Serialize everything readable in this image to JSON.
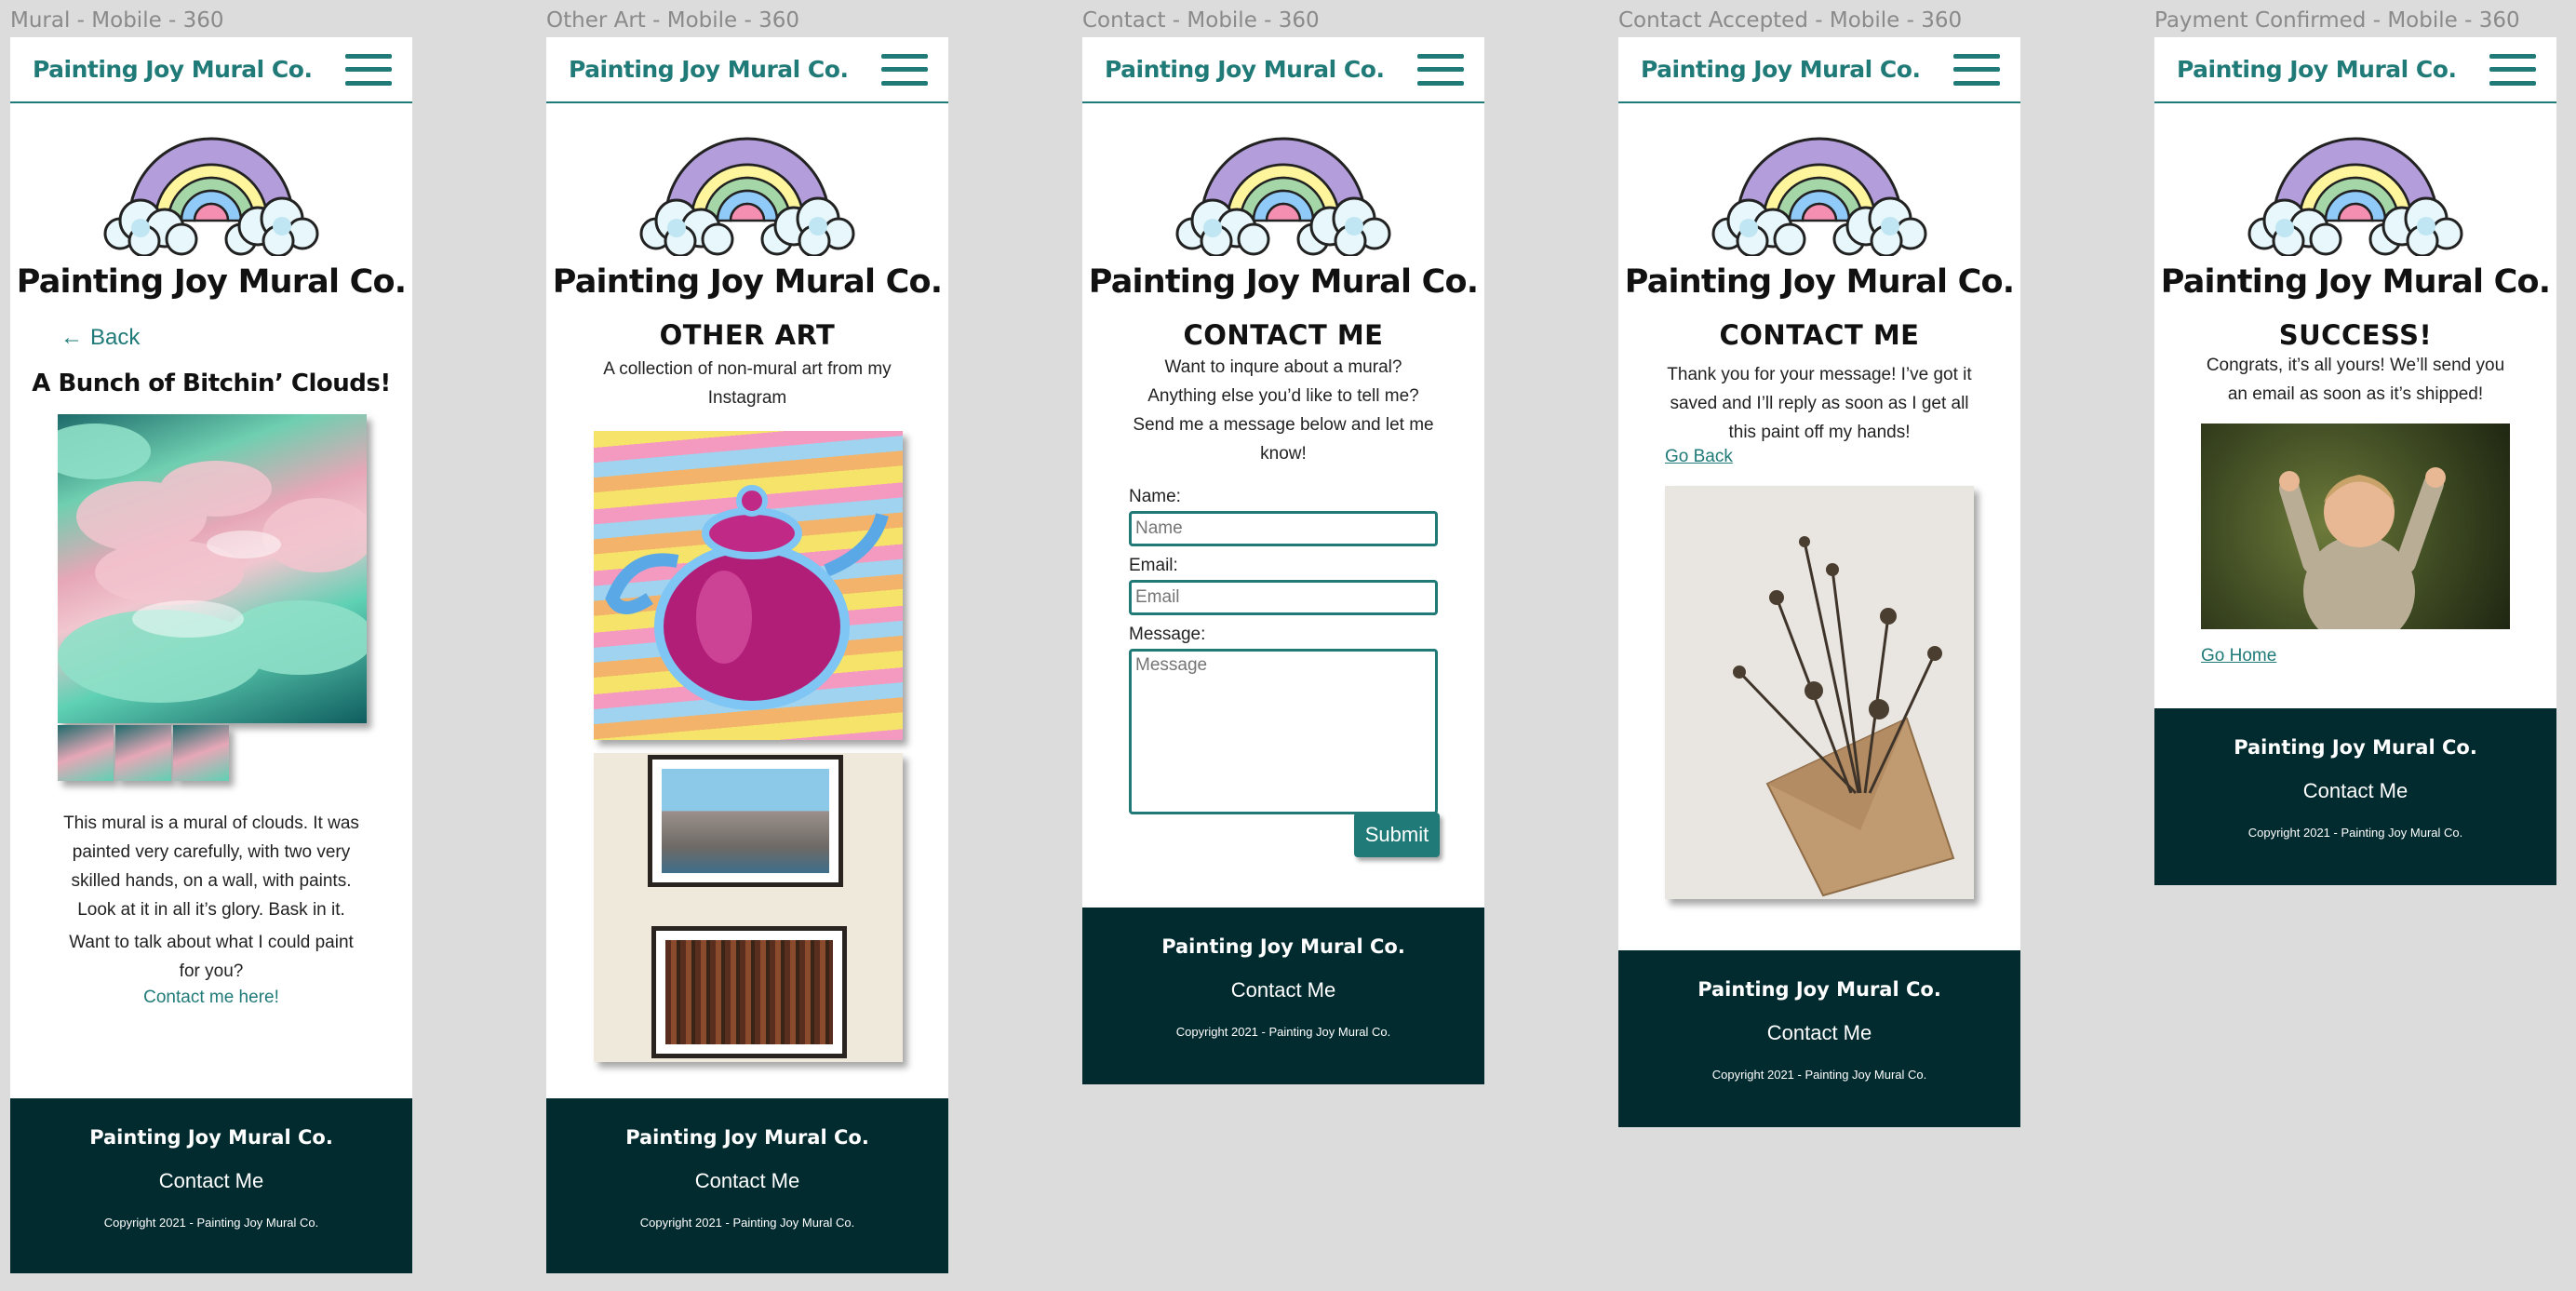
{
  "brand": "Painting Joy Mural Co.",
  "nav": {
    "menu_icon": "hamburger-menu-icon"
  },
  "footer": {
    "title": "Painting Joy Mural Co.",
    "link": "Contact Me",
    "copyright": "Copyright 2021 - Painting Joy Mural Co."
  },
  "colors": {
    "accent": "#1f7a78",
    "footer_bg": "#022b2f",
    "canvas_bg": "#dcdcdc"
  },
  "frames": {
    "mural": {
      "label": "Mural - Mobile - 360",
      "back": "Back",
      "heading": "A Bunch of Bitchin’ Clouds!",
      "description": "This mural is a mural of clouds. It was painted very carefully, with two very skilled hands, on a wall, with paints. Look at it in all it’s glory. Bask in it.",
      "cta_text": "Want to talk about what I could paint for you?",
      "cta_link": "Contact me here!"
    },
    "other_art": {
      "label": "Other Art - Mobile - 360",
      "heading": "OTHER ART",
      "intro": "A collection of non-mural art from my Instagram"
    },
    "contact": {
      "label": "Contact - Mobile - 360",
      "heading": "CONTACT ME",
      "intro": "Want to inqure about a mural? Anything else you’d like to tell me? Send me a message below and let me know!",
      "name_label": "Name:",
      "name_placeholder": "Name",
      "email_label": "Email:",
      "email_placeholder": "Email",
      "message_label": "Message:",
      "message_placeholder": "Message",
      "submit": "Submit"
    },
    "contact_accepted": {
      "label": "Contact Accepted - Mobile - 360",
      "heading": "CONTACT ME",
      "message": "Thank you for your message! I’ve got it saved and I’ll reply as soon as I get all this paint off my hands!",
      "link": "Go Back"
    },
    "payment_confirmed": {
      "label": "Payment Confirmed - Mobile - 360",
      "heading": "SUCCESS!",
      "message": "Congrats, it’s all yours! We’ll send you an email as soon as it’s shipped!",
      "link": "Go Home"
    }
  }
}
